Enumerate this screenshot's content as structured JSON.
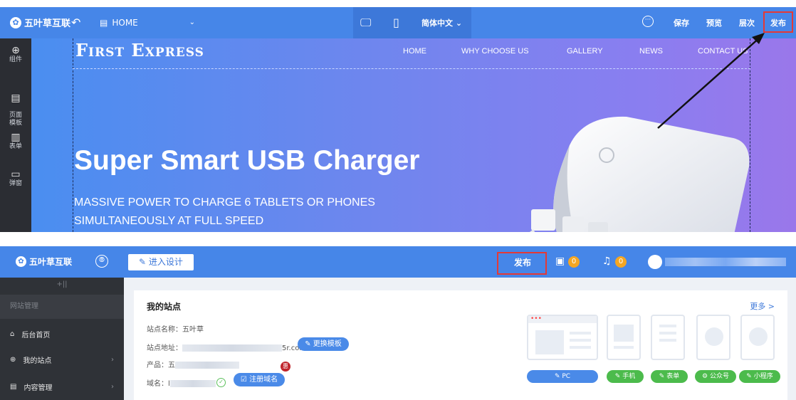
{
  "editor": {
    "toolbar": {
      "logo_text": "五叶草互联",
      "page_select": "HOME",
      "language": "简体中文",
      "save": "保存",
      "preview": "预览",
      "layers": "层次",
      "publish": "发布"
    },
    "sidebar": {
      "items": [
        {
          "label": "组件",
          "icon": "plus-circle-icon"
        },
        {
          "label": "页面\n模板",
          "icon": "page-icon"
        },
        {
          "label": "表单",
          "icon": "form-icon"
        },
        {
          "label": "弹窗",
          "icon": "popup-icon"
        }
      ]
    },
    "site": {
      "brand": "First Express",
      "nav": [
        "HOME",
        "WHY CHOOSE US",
        "GALLERY",
        "NEWS",
        "CONTACT US"
      ],
      "hero_title": "Super Smart USB Charger",
      "hero_line1": "MASSIVE POWER TO CHARGE 6 TABLETS  OR PHONES",
      "hero_line2": "SIMULTANEOUSLY AT FULL SPEED"
    }
  },
  "dashboard": {
    "topbar": {
      "logo_text": "五叶草互联",
      "enter_design": "进入设计",
      "publish": "发布",
      "task_count": "0",
      "notice_count": "0"
    },
    "sidebar": {
      "collapse_glyph": "+||",
      "group_label": "网站管理",
      "items": [
        {
          "label": "后台首页"
        },
        {
          "label": "我的站点"
        },
        {
          "label": "内容管理"
        }
      ]
    },
    "card": {
      "title": "我的站点",
      "more": "更多 >",
      "site_name_label": "站点名称：",
      "site_name": "五叶草",
      "site_url_label": "站点地址：",
      "site_url_tail": "5r.com",
      "change_template": "更换模板",
      "product_label": "产品：",
      "product_value": "五",
      "domain_label": "域名：",
      "domain_value": "l",
      "register_domain": "注册域名",
      "promo_badge": "惠",
      "templates": [
        "PC",
        "手机",
        "表单",
        "公众号",
        "小程序"
      ]
    }
  },
  "colors": {
    "toolbar_blue": "#4686e8",
    "highlight_red": "#e53935",
    "dark_sidebar": "#2b2d33",
    "green": "#4cbb4c",
    "badge_orange": "#f5a623"
  }
}
